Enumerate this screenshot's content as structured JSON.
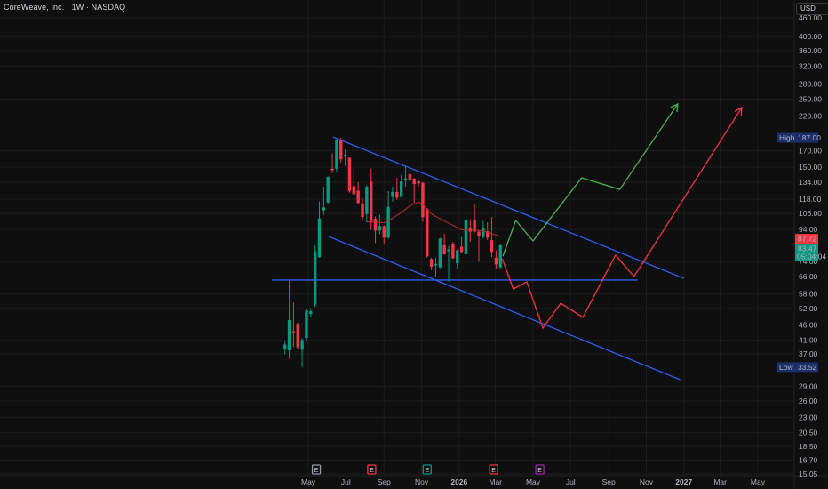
{
  "header": {
    "title": "CoreWeave, Inc. · 1W · NASDAQ",
    "currency_button": "USD"
  },
  "colors": {
    "background": "#0f0f0f",
    "up": "#089981",
    "down": "#f23645",
    "trendline": "#2f5ef0",
    "ma": "#b2302f",
    "bull_path": "#4caf50",
    "bear_path": "#f23645",
    "label_bg": "#1c2f6b"
  },
  "chart_data": {
    "type": "candlestick",
    "title": "CoreWeave, Inc. · 1W · NASDAQ",
    "interval": "1W",
    "y_scale": "log",
    "ylim": [
      15.05,
      460
    ],
    "grid": true,
    "y_ticks": [
      "460.00",
      "400.00",
      "360.00",
      "320.00",
      "280.00",
      "250.00",
      "220.00",
      "170.00",
      "150.00",
      "134.00",
      "118.00",
      "106.00",
      "94.00",
      "74.00",
      "66.00",
      "58.00",
      "52.00",
      "46.00",
      "41.00",
      "37.00",
      "29.00",
      "26.00",
      "23.00",
      "20.50",
      "18.50",
      "16.70",
      "15.05"
    ],
    "x_ticks": [
      {
        "label": "May",
        "date": "2025-05-01"
      },
      {
        "label": "Jul",
        "date": "2025-07-01"
      },
      {
        "label": "Sep",
        "date": "2025-09-01"
      },
      {
        "label": "Nov",
        "date": "2025-11-01"
      },
      {
        "label": "2026",
        "date": "2026-01-01"
      },
      {
        "label": "Mar",
        "date": "2026-03-01"
      },
      {
        "label": "May",
        "date": "2026-05-01"
      },
      {
        "label": "Jul",
        "date": "2026-07-01"
      },
      {
        "label": "Sep",
        "date": "2026-09-01"
      },
      {
        "label": "Nov",
        "date": "2026-11-01"
      },
      {
        "label": "2027",
        "date": "2027-01-01"
      },
      {
        "label": "Mar",
        "date": "2027-03-01"
      },
      {
        "label": "May",
        "date": "2027-05-01"
      }
    ],
    "first_bar_date": "2025-03-24",
    "ohlc": [
      [
        38.3,
        40.8,
        36.9,
        39.7
      ],
      [
        38.0,
        64.1,
        35.7,
        47.7
      ],
      [
        43.8,
        54.4,
        39.0,
        43.4
      ],
      [
        46.4,
        46.8,
        38.2,
        38.9
      ],
      [
        38.2,
        41.7,
        33.52,
        41.1
      ],
      [
        41.7,
        52.1,
        40.8,
        51.2
      ],
      [
        49.9,
        51.6,
        48.8,
        51.0
      ],
      [
        53.5,
        83.5,
        52.6,
        79.8
      ],
      [
        76.4,
        116.0,
        76.1,
        102.1
      ],
      [
        108.6,
        129.6,
        105.0,
        111.0
      ],
      [
        115.3,
        140.0,
        113.5,
        139.4
      ],
      [
        148.3,
        166.2,
        143.5,
        146.7
      ],
      [
        148.3,
        185.0,
        145.1,
        184.2
      ],
      [
        184.2,
        187.0,
        155.0,
        159.2
      ],
      [
        162.5,
        171.1,
        151.6,
        164.7
      ],
      [
        161.1,
        161.5,
        124.0,
        125.4
      ],
      [
        130.1,
        148.3,
        121.3,
        122.6
      ],
      [
        125.9,
        133.9,
        113.5,
        114.7
      ],
      [
        114.5,
        118.6,
        100.3,
        103.2
      ],
      [
        105.6,
        131.1,
        99.2,
        129.6
      ],
      [
        134.8,
        148.3,
        93.8,
        99.2
      ],
      [
        101.9,
        103.7,
        84.9,
        93.2
      ],
      [
        93.2,
        105.0,
        90.8,
        96.4
      ],
      [
        96.4,
        97.0,
        84.0,
        88.4
      ],
      [
        88.4,
        125.4,
        87.8,
        111.5
      ],
      [
        120.0,
        129.6,
        116.0,
        124.6
      ],
      [
        124.6,
        138.5,
        117.5,
        119.3
      ],
      [
        120.0,
        141.6,
        120.0,
        134.8
      ],
      [
        136.1,
        151.0,
        129.6,
        137.9
      ],
      [
        142.2,
        150.0,
        135.5,
        136.1
      ],
      [
        137.6,
        138.5,
        114.7,
        132.2
      ],
      [
        134.8,
        137.0,
        129.6,
        132.8
      ],
      [
        133.4,
        134.3,
        99.7,
        103.2
      ],
      [
        109.8,
        110.5,
        76.1,
        76.9
      ],
      [
        75.3,
        76.1,
        69.3,
        71.1
      ],
      [
        71.9,
        76.1,
        65.8,
        72.7
      ],
      [
        70.8,
        88.4,
        70.3,
        87.8
      ],
      [
        83.5,
        90.8,
        77.8,
        78.1
      ],
      [
        79.8,
        83.1,
        63.6,
        81.0
      ],
      [
        84.5,
        85.8,
        75.3,
        75.8
      ],
      [
        73.0,
        81.0,
        70.1,
        80.5
      ],
      [
        82.6,
        88.8,
        79.1,
        79.5
      ],
      [
        78.1,
        102.4,
        77.8,
        100.8
      ],
      [
        95.0,
        101.4,
        85.8,
        92.5
      ],
      [
        101.4,
        114.2,
        91.9,
        92.5
      ],
      [
        92.5,
        92.9,
        73.8,
        89.2
      ],
      [
        88.8,
        100.3,
        87.8,
        95.4
      ],
      [
        92.9,
        99.2,
        86.8,
        88.4
      ],
      [
        86.8,
        103.2,
        76.4,
        79.5
      ],
      [
        76.1,
        80.5,
        69.9,
        72.4
      ],
      [
        70.8,
        84.0,
        70.3,
        83.47
      ]
    ],
    "moving_average": [
      {
        "bar": 19,
        "value": 99.6
      },
      {
        "bar": 22,
        "value": 99.2
      },
      {
        "bar": 23,
        "value": 98.8
      },
      {
        "bar": 25,
        "value": 102.4
      },
      {
        "bar": 27,
        "value": 106.8
      },
      {
        "bar": 29,
        "value": 112.2
      },
      {
        "bar": 31,
        "value": 115.5
      },
      {
        "bar": 32,
        "value": 113.5
      },
      {
        "bar": 34,
        "value": 105.6
      },
      {
        "bar": 36,
        "value": 101.9
      },
      {
        "bar": 39,
        "value": 97.0
      },
      {
        "bar": 41,
        "value": 93.8
      },
      {
        "bar": 43,
        "value": 93.4
      },
      {
        "bar": 45,
        "value": 93.4
      },
      {
        "bar": 47,
        "value": 92.2
      },
      {
        "bar": 50,
        "value": 89.2
      }
    ],
    "trendlines": [
      {
        "name": "channel-upper",
        "points": [
          {
            "date": "2025-06-10",
            "price": 188.2
          },
          {
            "date": "2027-01-01",
            "price": 65.2
          }
        ]
      },
      {
        "name": "channel-lower",
        "points": [
          {
            "date": "2025-06-03",
            "price": 89.2
          },
          {
            "date": "2026-12-26",
            "price": 30.5
          }
        ]
      },
      {
        "name": "support-horizontal",
        "points": [
          {
            "date": "2025-03-03",
            "price": 64.4
          },
          {
            "date": "2026-10-18",
            "price": 64.4
          }
        ]
      }
    ],
    "projections": [
      {
        "name": "bull-path",
        "points": [
          {
            "date": "2026-03-13",
            "price": 77
          },
          {
            "date": "2026-04-03",
            "price": 100.6
          },
          {
            "date": "2026-05-01",
            "price": 86.3
          },
          {
            "date": "2026-07-19",
            "price": 138.5
          },
          {
            "date": "2026-09-19",
            "price": 127
          },
          {
            "date": "2026-12-22",
            "price": 241
          }
        ]
      },
      {
        "name": "bear-path",
        "points": [
          {
            "date": "2026-03-12",
            "price": 75.5
          },
          {
            "date": "2026-03-30",
            "price": 60.2
          },
          {
            "date": "2026-04-21",
            "price": 63.5
          },
          {
            "date": "2026-05-17",
            "price": 44.9
          },
          {
            "date": "2026-06-15",
            "price": 54.1
          },
          {
            "date": "2026-07-21",
            "price": 48.7
          },
          {
            "date": "2026-09-12",
            "price": 77.6
          },
          {
            "date": "2026-10-12",
            "price": 66.1
          },
          {
            "date": "2027-04-05",
            "price": 234.6
          }
        ]
      }
    ],
    "earnings_markers": [
      {
        "date": "2025-05-14",
        "label": "E",
        "color": "#9598a1"
      },
      {
        "date": "2025-08-12",
        "label": "E",
        "color": "#f23645"
      },
      {
        "date": "2025-11-10",
        "label": "E",
        "color": "#089981"
      },
      {
        "date": "2026-02-26",
        "label": "E",
        "color": "#f23645"
      },
      {
        "date": "2026-05-12",
        "label": "E",
        "color": "#9c27b0"
      }
    ],
    "price_labels": {
      "high_label": "High",
      "high_value": "187.00",
      "low_label": "Low",
      "low_value": "33.52",
      "prev_close": "87.72",
      "last_price": "83.47",
      "countdown": "05:04:04"
    }
  }
}
